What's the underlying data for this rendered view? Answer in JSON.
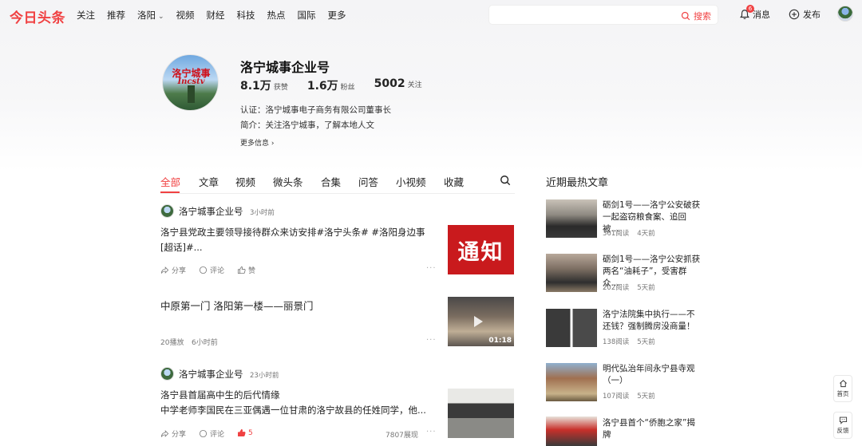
{
  "header": {
    "logo": "今日头条",
    "nav": [
      "关注",
      "推荐",
      "洛阳",
      "视频",
      "财经",
      "科技",
      "热点",
      "国际",
      "更多"
    ],
    "search_placeholder": "",
    "search_button": "搜索",
    "messages_label": "消息",
    "messages_badge": "6",
    "publish_label": "发布"
  },
  "profile": {
    "name": "洛宁城事企业号",
    "avatar_text_1": "洛宁城事",
    "avatar_text_2": "Incstv",
    "stats": [
      {
        "num": "8.1万",
        "label": "获赞"
      },
      {
        "num": "1.6万",
        "label": "粉丝"
      },
      {
        "num": "5002",
        "label": "关注"
      }
    ],
    "certification": "认证：洛宁城事电子商务有限公司董事长",
    "intro": "简介：关注洛宁城事，了解本地人文",
    "more_info": "更多信息 ›"
  },
  "tabs": [
    "全部",
    "文章",
    "视频",
    "微头条",
    "合集",
    "问答",
    "小视频",
    "收藏"
  ],
  "feed": [
    {
      "author": "洛宁城事企业号",
      "time": "3小时前",
      "text_line1": "洛宁县党政主要领导接待群众来访安排#洛宁头条# #洛阳身边事",
      "text_line2": "[超话]#...",
      "thumb_text": "通知",
      "share": "分享",
      "comment": "评论",
      "like": "赞"
    },
    {
      "title": "中原第一门 洛阳第一楼——丽景门",
      "duration": "01:18",
      "plays": "20播放",
      "time": "6小时前"
    },
    {
      "author": "洛宁城事企业号",
      "time": "23小时前",
      "text_line1": "洛宁县首届高中生的后代情缘",
      "text_line2": "中学老师李国民在三亚偶遇一位甘肃的洛宁故县的任姓同学，他...",
      "share": "分享",
      "comment": "评论",
      "like": "5",
      "views": "7807展现"
    }
  ],
  "sidebar": {
    "title": "近期最热文章",
    "items": [
      {
        "title": "砺剑1号——洛宁公安破获一起盗窃粮食案、追回被...",
        "reads": "361阅读",
        "time": "4天前"
      },
      {
        "title": "砺剑1号——洛宁公安抓获两名“油耗子”，受害群众...",
        "reads": "202阅读",
        "time": "5天前"
      },
      {
        "title": "洛宁法院集中执行——不还钱？强制腾房没商量！",
        "reads": "138阅读",
        "time": "5天前"
      },
      {
        "title": "明代弘治年间永宁县寺观（一）",
        "reads": "107阅读",
        "time": "5天前"
      },
      {
        "title": "洛宁县首个“侨胞之家”揭牌",
        "reads": "",
        "time": ""
      }
    ]
  },
  "floating": {
    "home": "首页",
    "feedback": "反馈"
  },
  "colors": {
    "brand": "#f04142"
  }
}
